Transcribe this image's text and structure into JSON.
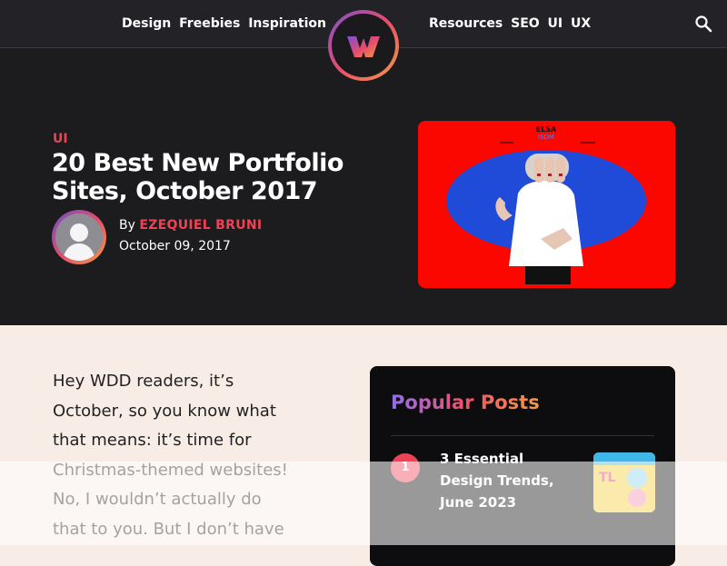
{
  "nav": {
    "left_items": [
      "Design",
      "Freebies",
      "Inspiration"
    ],
    "right_items": [
      "Resources",
      "SEO",
      "UI",
      "UX"
    ],
    "logo_letter": "W",
    "search_icon": "search-icon"
  },
  "article": {
    "category": "UI",
    "title": "20 Best New Portfolio Sites, October 2017",
    "by_label": "By",
    "author": "EZEQUIEL BRUNI",
    "date": "October 09, 2017",
    "body": "Hey WDD readers, it’s October, so you know what that means: it’s time for Christmas-themed websites! No, I wouldn’t actually do that to you. But I don’t have"
  },
  "hero_image": {
    "headline": "ELSA",
    "subline": "ISDM"
  },
  "sidebar": {
    "title": "Popular Posts",
    "posts": [
      {
        "rank": "1",
        "title": "3 Essential Design Trends, June 2023",
        "thumb_text": "TL"
      }
    ]
  },
  "colors": {
    "accent": "#ef4255",
    "dark_bg": "#1c1c1f",
    "page_bg": "#f7ece6",
    "hero_red": "#fb0700",
    "hero_blue": "#1f4bd8"
  }
}
